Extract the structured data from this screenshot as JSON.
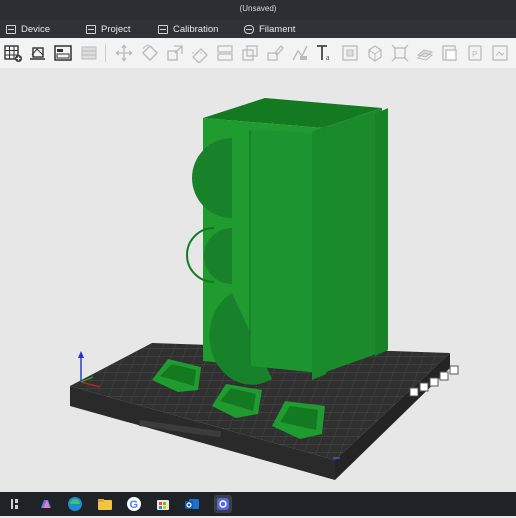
{
  "window": {
    "title": "(Unsaved)"
  },
  "menu": [
    {
      "label": "Device",
      "icon": "device-icon"
    },
    {
      "label": "Project",
      "icon": "project-icon"
    },
    {
      "label": "Calibration",
      "icon": "calibration-icon"
    },
    {
      "label": "Filament",
      "icon": "filament-icon"
    }
  ],
  "colors": {
    "model_green": "#1f9b2f",
    "model_green_dark": "#146e21",
    "bed": "#3b3b3b",
    "toolbar_bg": "#f3f3f3",
    "titlebar": "#2b2f33"
  },
  "toolbar_icons": [
    "grid-add-icon",
    "add-object-icon",
    "plate-layout-icon",
    "arrange-icon",
    "move-icon",
    "rotate-icon",
    "scale-icon",
    "cut-icon",
    "split-icon",
    "layers-icon",
    "paint-icon",
    "support-icon",
    "text-icon",
    "emboss-icon",
    "assembly-icon",
    "measure-icon",
    "boolean-icon",
    "variable-layer-icon",
    "slice-view-icon",
    "preview-icon",
    "settings-icon"
  ],
  "taskbar_icons": [
    "start-icon",
    "copilot-icon",
    "edge-icon",
    "file-explorer-icon",
    "google-chrome-icon",
    "store-icon",
    "outlook-icon",
    "bambu-studio-icon"
  ]
}
